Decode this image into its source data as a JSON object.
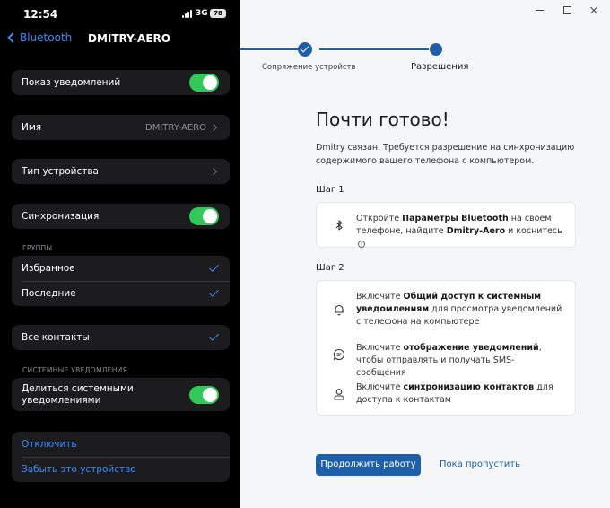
{
  "phone": {
    "status": {
      "time": "12:54",
      "network": "3G",
      "battery": "78"
    },
    "nav": {
      "back_label": "Bluetooth",
      "title": "DMITRY-AERO"
    },
    "rows": {
      "notifications": "Показ уведомлений",
      "name_label": "Имя",
      "name_value": "DMITRY-AERO",
      "device_type": "Тип устройства",
      "sync": "Синхронизация",
      "groups_header": "ГРУППЫ",
      "favorites": "Избранное",
      "recents": "Последние",
      "all_contacts": "Все контакты",
      "system_notifications_header": "СИСТЕМНЫЕ УВЕДОМЛЕНИЯ",
      "share_notifications_line1": "Делиться системными",
      "share_notifications_line2": "уведомлениями",
      "disconnect": "Отключить",
      "forget_device": "Забыть это устройство"
    },
    "toggles": {
      "notifications": true,
      "sync": true,
      "share_notifications": true
    },
    "colors": {
      "accent": "#3a8bff",
      "toggle_on": "#34c759"
    }
  },
  "app": {
    "steps": [
      {
        "label": "Сопряжение устройств",
        "state": "done"
      },
      {
        "label": "Разрешения",
        "state": "current"
      }
    ],
    "heading": "Почти готово!",
    "intro": "Dmitry связан. Требуется разрешение на синхронизацию содержимого вашего телефона с компьютером.",
    "step1": {
      "title": "Шаг 1",
      "text1": "Откройте ",
      "bold1": "Параметры Bluetooth",
      "text2": " на своем телефоне, найдите ",
      "bold2": "Dmitry-Aero",
      "text3": " и коснитесь",
      "info_glyph": "i"
    },
    "step2": {
      "title": "Шаг 2",
      "item1": {
        "text1": "Включите ",
        "bold": "Общий доступ к системным уведомлениям",
        "text2": " для просмотра уведомлений с телефона на компьютере"
      },
      "item2": {
        "text1": "Включите ",
        "bold": "отображение уведомлений",
        "text2": ", чтобы отправлять и получать SMS-сообщения"
      },
      "item3": {
        "text1": "Включите ",
        "bold": "синхронизацию контактов",
        "text2": " для доступа к контактам"
      }
    },
    "buttons": {
      "continue": "Продолжить работу",
      "skip": "Пока пропустить"
    },
    "colors": {
      "primary": "#1f5fa8"
    }
  }
}
